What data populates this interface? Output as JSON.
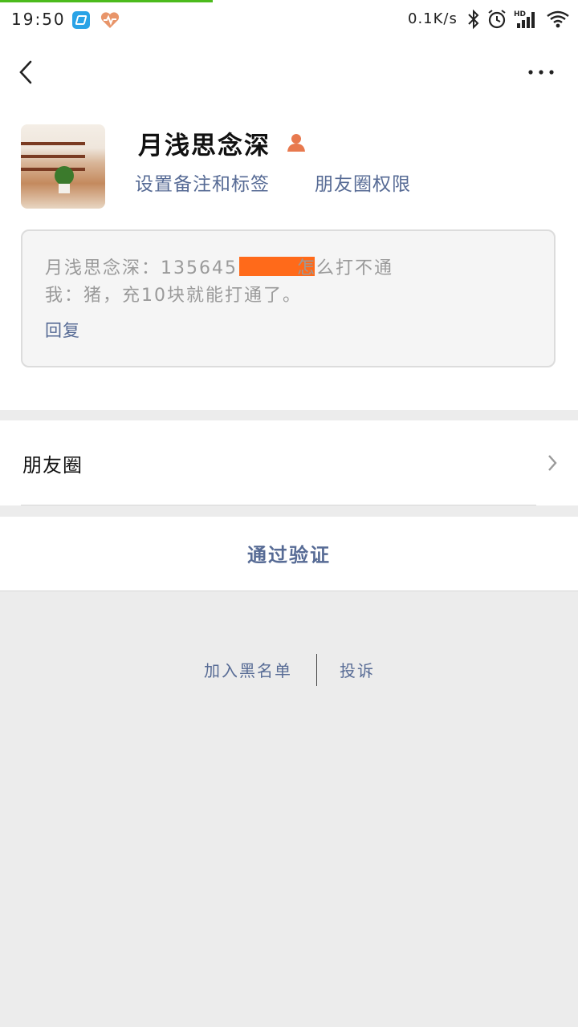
{
  "status_bar": {
    "time": "19:50",
    "net_speed": "0.1K/s",
    "signal_label": "HD"
  },
  "nav": {
    "back_icon": "chevron-left-icon",
    "more_icon": "more-dots-icon"
  },
  "profile": {
    "name": "月浅思念深",
    "set_remark_label": "设置备注和标签",
    "moments_permission_label": "朋友圈权限"
  },
  "message": {
    "line1_prefix": "月浅思念深：135645",
    "line1_suffix": "怎么打不通",
    "line2": "我：猪，充10块就能打通了。",
    "reply_label": "回复"
  },
  "moments": {
    "label": "朋友圈"
  },
  "actions": {
    "verify_label": "通过验证",
    "blacklist_label": "加入黑名单",
    "report_label": "投诉"
  },
  "colors": {
    "link": "#576b95",
    "redaction": "#ff6a1a",
    "progress": "#4cbb1c"
  }
}
